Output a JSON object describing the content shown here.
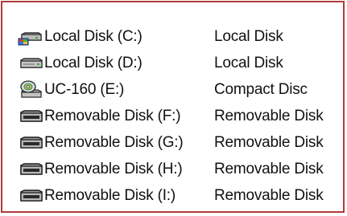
{
  "drives": [
    {
      "name": "Local Disk (C:)",
      "type": "Local Disk",
      "icon": "local-disk-system-icon"
    },
    {
      "name": "Local Disk (D:)",
      "type": "Local Disk",
      "icon": "local-disk-icon"
    },
    {
      "name": "UC-160 (E:)",
      "type": "Compact Disc",
      "icon": "cd-drive-icon"
    },
    {
      "name": "Removable Disk (F:)",
      "type": "Removable Disk",
      "icon": "removable-disk-icon"
    },
    {
      "name": "Removable Disk (G:)",
      "type": "Removable Disk",
      "icon": "removable-disk-icon"
    },
    {
      "name": "Removable Disk (H:)",
      "type": "Removable Disk",
      "icon": "removable-disk-icon"
    },
    {
      "name": "Removable Disk (I:)",
      "type": "Removable Disk",
      "icon": "removable-disk-icon"
    }
  ],
  "colors": {
    "frame_border": "#b03a3a",
    "text": "#111111",
    "background": "#ffffff"
  }
}
